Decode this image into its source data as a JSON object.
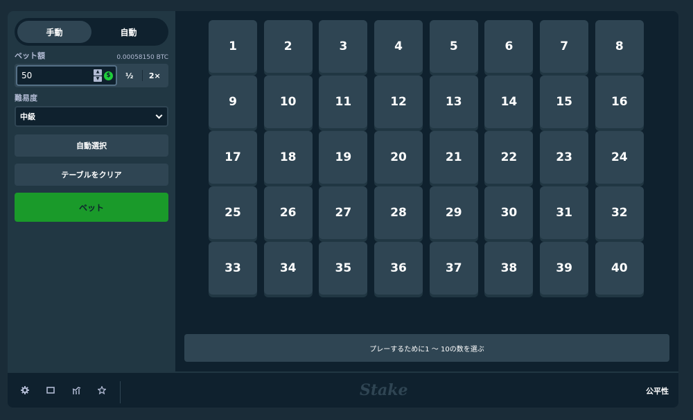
{
  "mode_toggle": {
    "manual": "手動",
    "auto": "自動"
  },
  "bet": {
    "label": "ベット額",
    "btc_amount": "0.00058150 BTC",
    "value": "50",
    "coin_symbol": "$",
    "half": "½",
    "double": "2×"
  },
  "difficulty": {
    "label": "難易度",
    "selected": "中級"
  },
  "buttons": {
    "auto_pick": "自動選択",
    "clear_table": "テーブルをクリア",
    "bet": "ベット"
  },
  "tiles": [
    "1",
    "2",
    "3",
    "4",
    "5",
    "6",
    "7",
    "8",
    "9",
    "10",
    "11",
    "12",
    "13",
    "14",
    "15",
    "16",
    "17",
    "18",
    "19",
    "20",
    "21",
    "22",
    "23",
    "24",
    "25",
    "26",
    "27",
    "28",
    "29",
    "30",
    "31",
    "32",
    "33",
    "34",
    "35",
    "36",
    "37",
    "38",
    "39",
    "40"
  ],
  "message": "プレーするために1 〜 10の数を選ぶ",
  "footer": {
    "logo": "Stake",
    "fairness": "公平性",
    "icons": [
      "gear-icon",
      "square-icon",
      "chart-icon",
      "star-icon"
    ]
  },
  "colors": {
    "page_bg": "#1a2c38",
    "panel_bg": "#0f212e",
    "sidebar_bg": "#213743",
    "tile_bg": "#2f4553",
    "bet_green": "#1a9a2a",
    "coin_green": "#1fce3b"
  }
}
